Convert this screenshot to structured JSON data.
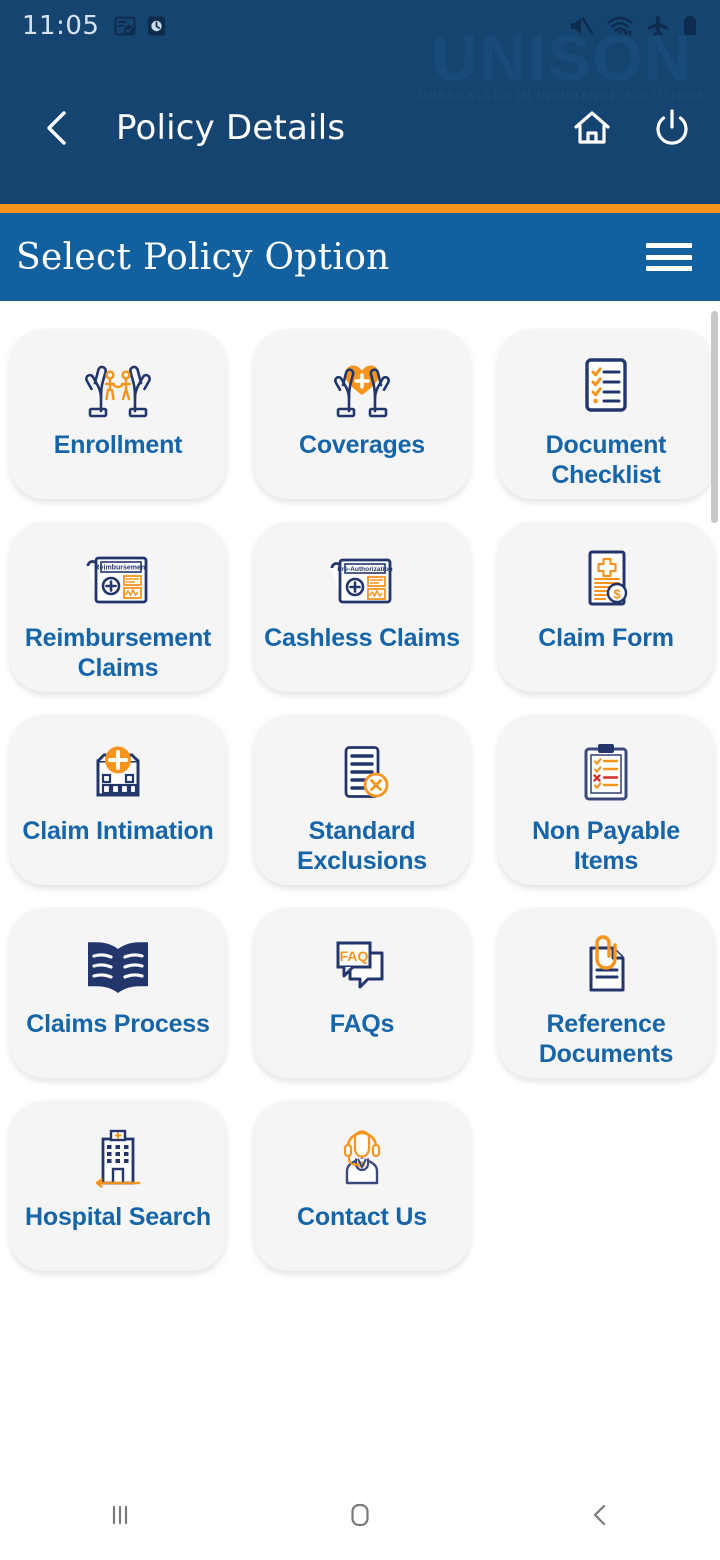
{
  "statusbar": {
    "time": "11:05",
    "left_icons": [
      "calendar-check-icon",
      "alarm-icon"
    ],
    "right_icons": [
      "mute-icon",
      "wifi-icon",
      "airplane-mode-icon",
      "battery-icon"
    ]
  },
  "watermark": {
    "name": "UNISON",
    "tagline": "UNPARALLED IN INSURANCE SOLUTIONS"
  },
  "appbar": {
    "back_icon": "chevron-left-icon",
    "title": "Policy Details",
    "home_icon": "home-icon",
    "power_icon": "power-icon"
  },
  "section": {
    "title": "Select Policy Option",
    "menu_icon": "hamburger-menu-icon"
  },
  "colors": {
    "statusbar_bg": "#164470",
    "appbar_bg": "#164470",
    "accent_orange": "#F7941E",
    "section_bg": "#13609F",
    "tile_bg": "#f5f5f5",
    "label_blue": "#1565a8",
    "icon_navy": "#23366b"
  },
  "tiles": [
    {
      "id": "enrollment",
      "label": "Enrollment",
      "icon": "hands-family-icon"
    },
    {
      "id": "coverages",
      "label": "Coverages",
      "icon": "hands-heart-icon"
    },
    {
      "id": "document-checklist",
      "label": "Document\nChecklist",
      "icon": "checklist-document-icon"
    },
    {
      "id": "reimbursement-claims",
      "label": "Reimbursement\nClaims",
      "icon": "reimbursement-form-icon"
    },
    {
      "id": "cashless-claims",
      "label": "Cashless Claims",
      "icon": "preauthorization-form-icon"
    },
    {
      "id": "claim-form",
      "label": "Claim Form",
      "icon": "claim-form-icon"
    },
    {
      "id": "claim-intimation",
      "label": "Claim Intimation",
      "icon": "hospital-cross-icon"
    },
    {
      "id": "standard-exclusions",
      "label": "Standard\nExclusions",
      "icon": "document-cross-out-icon"
    },
    {
      "id": "non-payable-items",
      "label": "Non Payable\nItems",
      "icon": "clipboard-x-icon"
    },
    {
      "id": "claims-process",
      "label": "Claims Process",
      "icon": "open-book-icon"
    },
    {
      "id": "faqs",
      "label": "FAQs",
      "icon": "faq-chat-icon"
    },
    {
      "id": "reference-documents",
      "label": "Reference\nDocuments",
      "icon": "paperclip-document-icon"
    },
    {
      "id": "hospital-search",
      "label": "Hospital Search",
      "icon": "hospital-building-icon"
    },
    {
      "id": "contact-us",
      "label": "Contact Us",
      "icon": "headset-agent-icon"
    }
  ],
  "navbar": {
    "recents_icon": "recents-icon",
    "home_icon": "home-square-icon",
    "back_icon": "back-chevron-icon"
  }
}
